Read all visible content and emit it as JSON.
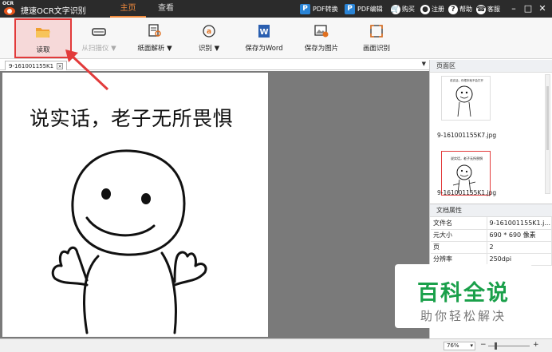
{
  "titlebar": {
    "logo_text": "OCR",
    "app_title": "捷速OCR文字识别",
    "tabs": [
      {
        "label": "主页",
        "active": true
      },
      {
        "label": "查看",
        "active": false
      }
    ],
    "actions": {
      "pdf_convert": "PDF转换",
      "pdf_edit": "PDF编辑",
      "buy": "购买",
      "register": "注册",
      "help": "帮助",
      "support": "客服"
    },
    "accent_color": "#f08a3c"
  },
  "toolbar": {
    "read": "读取",
    "scanner": "从扫描仪 ▼",
    "layout_analysis": "纸面解析 ▼",
    "recognize": "识别 ▼",
    "save_word": "保存为Word",
    "save_image": "保存为图片",
    "screen_recognize": "画面识别"
  },
  "document": {
    "tab_label": "9-161001155K1",
    "meme_caption": "说实话，老子无所畏惧"
  },
  "page_panel": {
    "title": "页面区",
    "thumbnails": [
      {
        "caption": "9-161001155K7.jpg",
        "selected": false,
        "thumb_text": "说实话，你根本就不会打开"
      },
      {
        "caption": "9-161001155K1.jpg",
        "selected": true,
        "thumb_text": "说实话，老子无所畏惧"
      }
    ]
  },
  "properties": {
    "title": "文档属性",
    "rows": [
      {
        "key": "文件名",
        "value": "9-161001155K1.j..."
      },
      {
        "key": "元大小",
        "value": "690 * 690 像素"
      },
      {
        "key": "页",
        "value": "2"
      },
      {
        "key": "分辨率",
        "value": "250dpi"
      }
    ]
  },
  "watermark": {
    "title": "百科全说",
    "subtitle": "助你轻松解决"
  },
  "statusbar": {
    "zoom": "76%",
    "zoom_minus": "−",
    "zoom_plus": "+"
  }
}
